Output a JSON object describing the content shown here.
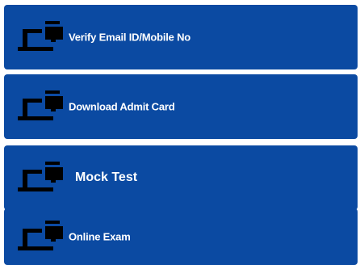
{
  "menu": {
    "items": [
      {
        "label": "Verify Email ID/Mobile No",
        "icon": "desktop-computer-icon"
      },
      {
        "label": "Download Admit Card",
        "icon": "desktop-computer-icon"
      },
      {
        "label": "Mock Test",
        "icon": "desktop-computer-icon"
      },
      {
        "label": "Online Exam",
        "icon": "desktop-computer-icon"
      }
    ]
  },
  "colors": {
    "card_background": "#0b4aa2",
    "icon": "#000000",
    "label": "#ffffff"
  }
}
